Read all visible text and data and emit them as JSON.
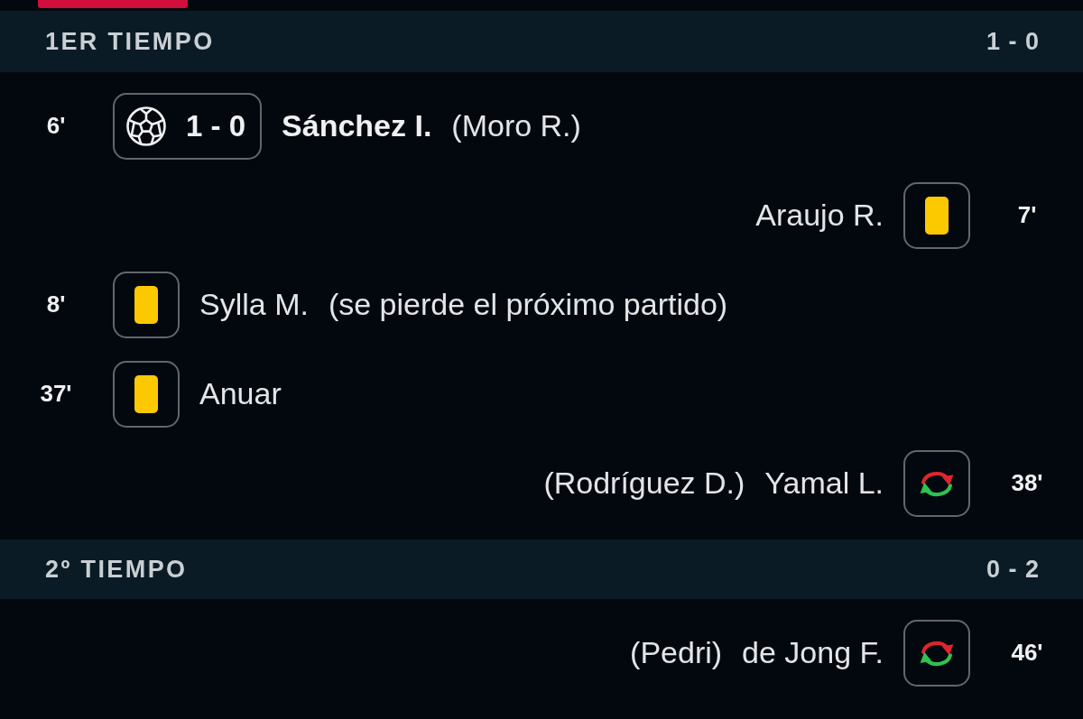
{
  "periods": [
    {
      "title": "1ER TIEMPO",
      "score": "1 - 0",
      "events": [
        {
          "away": false,
          "minute": "6'",
          "kind": "goal",
          "score": "1 - 0",
          "player": "Sánchez I.",
          "detail": "(Moro R.)"
        },
        {
          "away": true,
          "minute": "7'",
          "kind": "yellow_card",
          "player": "Araujo R."
        },
        {
          "away": false,
          "minute": "8'",
          "kind": "yellow_card",
          "player": "Sylla M.",
          "detail": "(se pierde el próximo partido)"
        },
        {
          "away": false,
          "minute": "37'",
          "kind": "yellow_card",
          "player": "Anuar"
        },
        {
          "away": true,
          "minute": "38'",
          "kind": "substitution",
          "player": "Yamal L.",
          "detail": "(Rodríguez D.)"
        }
      ]
    },
    {
      "title": "2º TIEMPO",
      "score": "0 - 2",
      "events": [
        {
          "away": true,
          "minute": "46'",
          "kind": "substitution",
          "player": "de Jong F.",
          "detail": "(Pedri)"
        }
      ]
    }
  ]
}
